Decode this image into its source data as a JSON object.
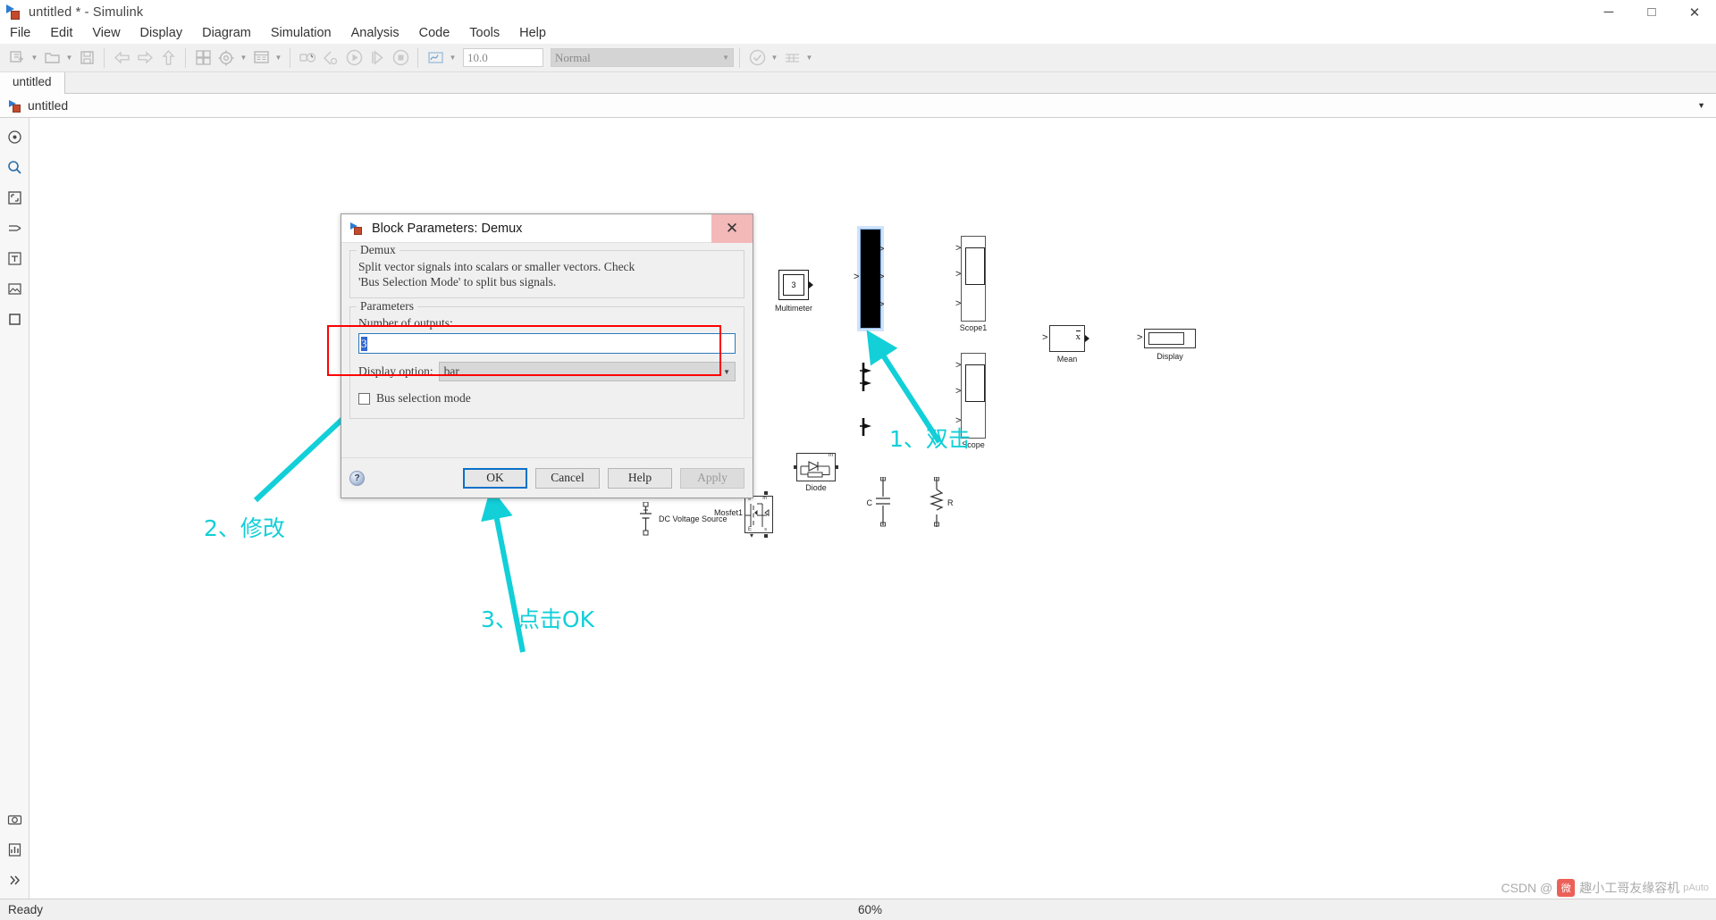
{
  "window": {
    "title": "untitled * - Simulink",
    "icon": "simulink-logo-icon",
    "minimize": "─",
    "maximize": "□",
    "close": "✕"
  },
  "menubar": {
    "items": [
      "File",
      "Edit",
      "View",
      "Display",
      "Diagram",
      "Simulation",
      "Analysis",
      "Code",
      "Tools",
      "Help"
    ]
  },
  "toolbar": {
    "sim_time": "10.0",
    "sim_mode": "Normal",
    "buttons": [
      "new-model-icon",
      "open-folder-icon",
      "save-icon",
      "back-arrow-icon",
      "forward-arrow-icon",
      "up-arrow-icon",
      "library-browser-icon",
      "model-settings-gear-icon",
      "model-explorer-icon",
      "update-model-icon",
      "fast-restart-icon",
      "run-icon",
      "step-forward-icon",
      "stop-icon",
      "signal-logging-icon",
      "check-model-icon",
      "layout-grid-icon"
    ]
  },
  "tab": {
    "label": "untitled"
  },
  "breadcrumb": {
    "label": "untitled",
    "caret": "▼"
  },
  "palette": {
    "items": [
      "navigate-icon",
      "zoom-icon",
      "fit-to-view-icon",
      "route-signal-icon",
      "annotation-text-icon",
      "image-icon",
      "area-icon",
      "camera-icon",
      "report-icon",
      "expand-icon"
    ]
  },
  "dialog": {
    "title": "Block Parameters: Demux",
    "close": "✕",
    "group_block": {
      "legend": "Demux",
      "description": "Split vector signals into scalars or smaller vectors. Check\n'Bus Selection Mode' to split bus signals."
    },
    "group_params": {
      "legend": "Parameters",
      "number_of_outputs_label": "Number of outputs:",
      "number_of_outputs_value": "3",
      "display_option_label": "Display option:",
      "display_option_value": "bar",
      "bus_selection_label": "Bus selection mode",
      "bus_selection_checked": false
    },
    "footer": {
      "help_orb": "?",
      "ok": "OK",
      "cancel": "Cancel",
      "help": "Help",
      "apply": "Apply"
    }
  },
  "canvas": {
    "blocks": [
      {
        "name": "Multimeter",
        "label": "Multimeter",
        "value": "3"
      },
      {
        "name": "Demux",
        "label": "",
        "selected": true,
        "outputs": 3
      },
      {
        "name": "Scope1",
        "label": "Scope1",
        "inputs": 3
      },
      {
        "name": "Scope",
        "label": "Scope",
        "inputs": 3
      },
      {
        "name": "Mean",
        "label": "Mean",
        "symbol": "x"
      },
      {
        "name": "Display",
        "label": "Display"
      },
      {
        "name": "Diode",
        "label": "Diode"
      },
      {
        "name": "DC Voltage Source",
        "label": "DC Voltage Source"
      },
      {
        "name": "Mosfet1",
        "label": "Mosfet1",
        "pins": [
          "g",
          "m",
          "E",
          "s"
        ]
      },
      {
        "name": "Capacitor",
        "label": "C"
      },
      {
        "name": "Resistor",
        "label": "R"
      }
    ]
  },
  "annotations": [
    {
      "id": "step1",
      "text": "1、双击",
      "color": "#12cfd8"
    },
    {
      "id": "step2",
      "text": "2、修改",
      "color": "#12cfd8"
    },
    {
      "id": "step3",
      "text": "3、点击OK",
      "color": "#12cfd8"
    }
  ],
  "statusbar": {
    "ready": "Ready",
    "zoom": "60%"
  },
  "watermark": {
    "prefix": "CSDN @",
    "badge": "微",
    "text": "趣小工哥友缘容机",
    "tail": "pAuto"
  },
  "colors": {
    "accent_blue": "#0a71c8",
    "annotation_cyan": "#12cfd8",
    "highlight_red": "#ff0000",
    "selection_blue": "#cfe3fa",
    "close_pink": "#f3b8b8"
  }
}
